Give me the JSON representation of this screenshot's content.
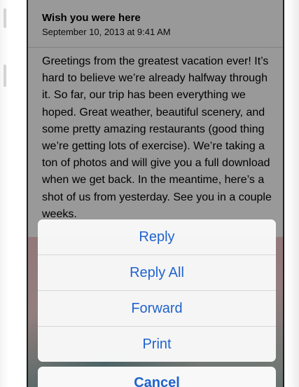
{
  "email": {
    "subject": "Wish you were here",
    "date": "September 10, 2013 at 9:41 AM",
    "body": "Greetings from the greatest vacation ever! It’s hard to believe we’re already halfway through it. So far, our trip has been everything we hoped. Great weather, beautiful scenery, and some pretty amazing restaurants (good thing we’re getting lots of exercise). We’re taking a ton of photos and will give you a full download when we get back. In the meantime, here’s a shot of us from yesterday. See you in a couple weeks."
  },
  "action_sheet": {
    "items": [
      {
        "label": "Reply"
      },
      {
        "label": "Reply All"
      },
      {
        "label": "Forward"
      },
      {
        "label": "Print"
      }
    ],
    "cancel_label": "Cancel"
  },
  "colors": {
    "accent": "#1f63ce",
    "overlay": "rgba(0,0,0,0.40)"
  }
}
